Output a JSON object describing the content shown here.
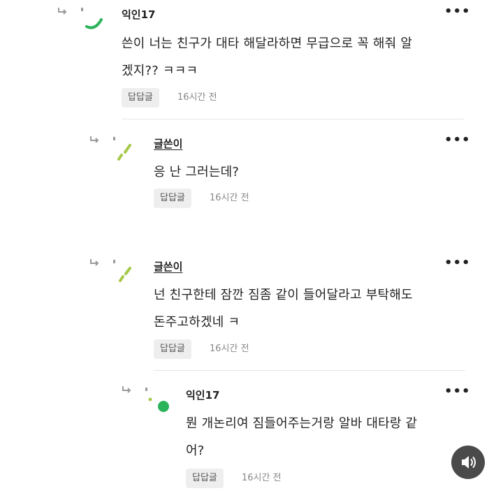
{
  "comments": [
    {
      "author": "익인17",
      "lines": [
        "쓴이 너는 친구가 대타 해달라하면 무급으로 꼭 해줘 알",
        "겠지?? ㅋㅋㅋ"
      ],
      "reply_label": "답답글",
      "time": "16시간 전",
      "more": "•••"
    },
    {
      "author": "글쓴이",
      "lines": [
        "응 난 그러는데?"
      ],
      "reply_label": "답답글",
      "time": "16시간 전",
      "more": "•••"
    },
    {
      "author": "글쓴이",
      "lines": [
        "넌 친구한테 잠깐 짐좀 같이 들어달라고 부탁해도",
        "돈주고하겠네 ㅋ"
      ],
      "reply_label": "답답글",
      "time": "16시간 전",
      "more": "•••"
    },
    {
      "author": "익인17",
      "lines": [
        "뭔 개논리여 짐들어주는거랑 알바 대타랑 같",
        "어?"
      ],
      "reply_label": "답답글",
      "time": "16시간 전",
      "more": "•••"
    }
  ],
  "colors": {
    "avatar_green": "#2bb35a",
    "avatar_lime": "#a6c94a",
    "reply_bg": "#eeeeee",
    "sound_button": "#4a4a4a"
  },
  "icons": {
    "reply_arrow": "reply-arrow-icon",
    "more": "more-dots-icon",
    "sound": "speaker-icon"
  }
}
